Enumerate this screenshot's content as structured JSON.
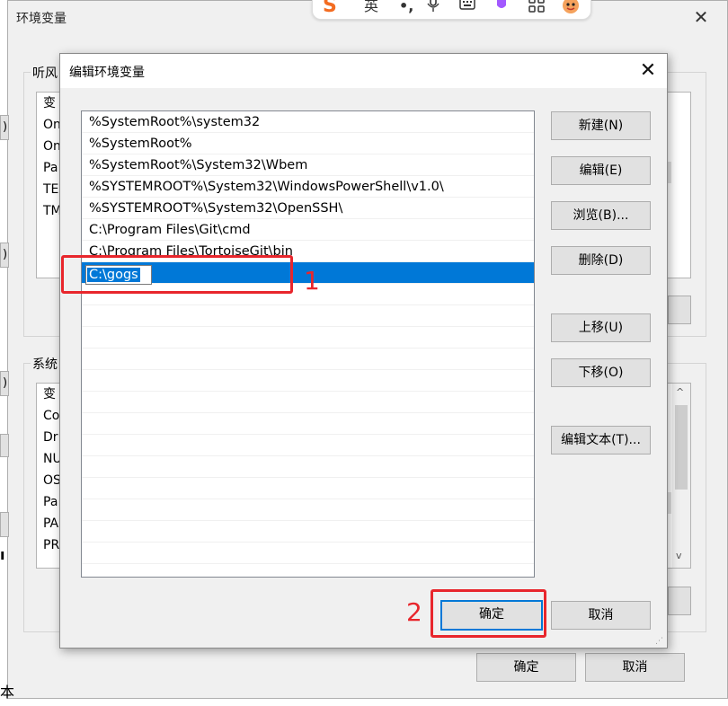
{
  "bg_window": {
    "title": "环境变量",
    "user_group_label": "听风",
    "user_vars": [
      "变",
      "On",
      "On",
      "Pa",
      "TE",
      "TM"
    ],
    "system_group_label": "系统",
    "system_vars": [
      "变",
      "Co",
      "Dr",
      "NU",
      "OS",
      "Pa",
      "PA",
      "PR"
    ],
    "left_fragments": [
      ").",
      ").",
      ").",
      "ı",
      "本"
    ],
    "ok_label": "确定",
    "cancel_label": "取消"
  },
  "ime_bar": {
    "items": [
      "S",
      "英",
      "•,",
      "mic-icon",
      "keyboard-icon",
      "skin-icon",
      "apps-icon",
      "avatar-icon"
    ],
    "lang": "英"
  },
  "dialog": {
    "title": "编辑环境变量",
    "paths": [
      "%SystemRoot%\\system32",
      "%SystemRoot%",
      "%SystemRoot%\\System32\\Wbem",
      "%SYSTEMROOT%\\System32\\WindowsPowerShell\\v1.0\\",
      "%SYSTEMROOT%\\System32\\OpenSSH\\",
      "C:\\Program Files\\Git\\cmd",
      "C:\\Program Files\\TortoiseGit\\bin"
    ],
    "editing_value": "C:\\gogs",
    "buttons": {
      "new": "新建(N)",
      "edit": "编辑(E)",
      "browse": "浏览(B)...",
      "delete": "删除(D)",
      "move_up": "上移(U)",
      "move_down": "下移(O)",
      "edit_text": "编辑文本(T)...",
      "ok": "确定",
      "cancel": "取消"
    }
  },
  "annotations": {
    "step1": "1",
    "step2": "2",
    "color": "#e8262c"
  }
}
